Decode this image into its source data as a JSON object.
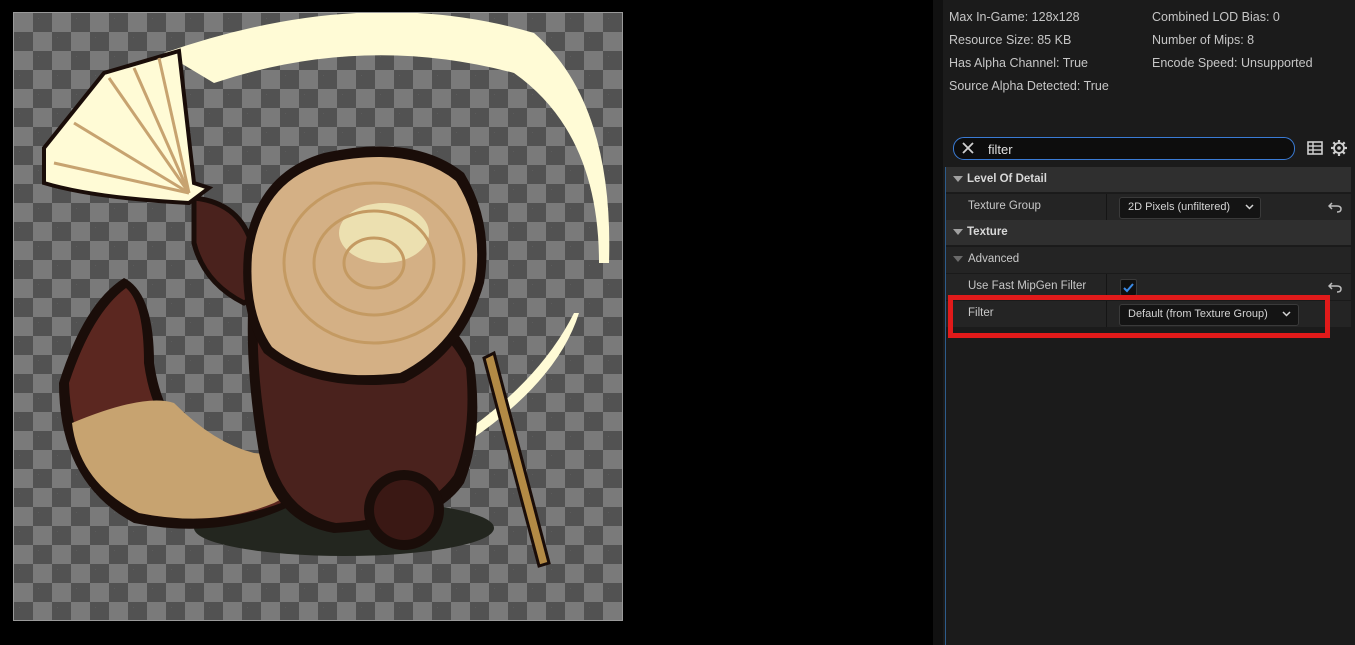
{
  "texture_info": {
    "left": [
      "Max In-Game: 128x128",
      "Resource Size: 85 KB",
      "Has Alpha Channel: True",
      "Source Alpha Detected: True"
    ],
    "right": [
      "Combined LOD Bias: 0",
      "Number of Mips: 8",
      "Encode Speed: Unsupported"
    ]
  },
  "search": {
    "value": "filter",
    "clear_icon": "close-icon"
  },
  "toolbar": {
    "table_icon": "table-view-icon",
    "settings_icon": "gear-icon"
  },
  "categories": {
    "level_of_detail": "Level Of Detail",
    "texture": "Texture",
    "advanced": "Advanced"
  },
  "properties": {
    "texture_group": {
      "label": "Texture Group",
      "value": "2D Pixels (unfiltered)"
    },
    "use_fast_mipgen_filter": {
      "label": "Use Fast MipGen Filter",
      "checked": true
    },
    "filter": {
      "label": "Filter",
      "value": "Default (from Texture Group)"
    }
  },
  "colors": {
    "highlight": "#e11a1a",
    "accent": "#3a7bd5"
  }
}
